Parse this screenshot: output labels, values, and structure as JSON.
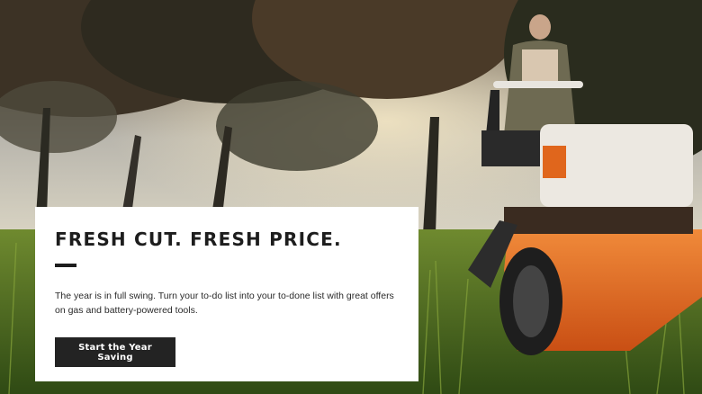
{
  "hero": {
    "headline": "FRESH CUT. FRESH PRICE.",
    "body": "The year is in full swing. Turn your to-do list into your to-done list with great offers on gas and battery-powered tools.",
    "cta_label": "Start the Year Saving"
  },
  "colors": {
    "card_bg": "#ffffff",
    "text": "#1d1d1d",
    "button_bg": "#232323",
    "mower_orange": "#e8641c",
    "grass_green": "#4d6b1f"
  }
}
